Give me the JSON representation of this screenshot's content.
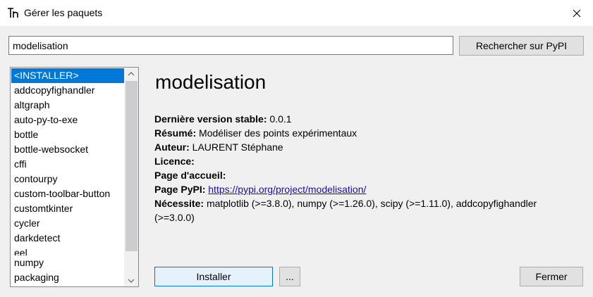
{
  "window": {
    "title": "Gérer les paquets",
    "icon": "thonny-app-icon",
    "close_icon": "close-icon"
  },
  "search": {
    "value": "modelisation",
    "button_label": "Rechercher sur PyPI"
  },
  "package_list": {
    "items": [
      "<INSTALLER>",
      "addcopyfighandler",
      "altgraph",
      "auto-py-to-exe",
      "bottle",
      "bottle-websocket",
      "cffi",
      "contourpy",
      "custom-toolbar-button",
      "customtkinter",
      "cycler",
      "darkdetect",
      "eel",
      "numpy",
      "packaging"
    ],
    "selected_index": 0
  },
  "package": {
    "name": "modelisation",
    "fields": {
      "latest_version_label": "Dernière version stable:",
      "latest_version": "0.0.1",
      "summary_label": "Résumé:",
      "summary": "Modéliser des points expérimentaux",
      "author_label": "Auteur:",
      "author": "LAURENT Stéphane",
      "license_label": "Licence:",
      "license": "",
      "homepage_label": "Page d'accueil:",
      "homepage": "",
      "pypi_label": "Page PyPI:",
      "pypi_url": "https://pypi.org/project/modelisation/",
      "requires_label": "Nécessite:",
      "requires": "matplotlib (>=3.8.0), numpy (>=1.26.0), scipy (>=1.11.0), addcopyfighandler (>=3.0.0)"
    }
  },
  "buttons": {
    "install": "Installer",
    "more": "...",
    "close": "Fermer"
  },
  "colors": {
    "selection": "#0078d7",
    "link": "#1a0dab",
    "default_button_border": "#0078d7"
  }
}
